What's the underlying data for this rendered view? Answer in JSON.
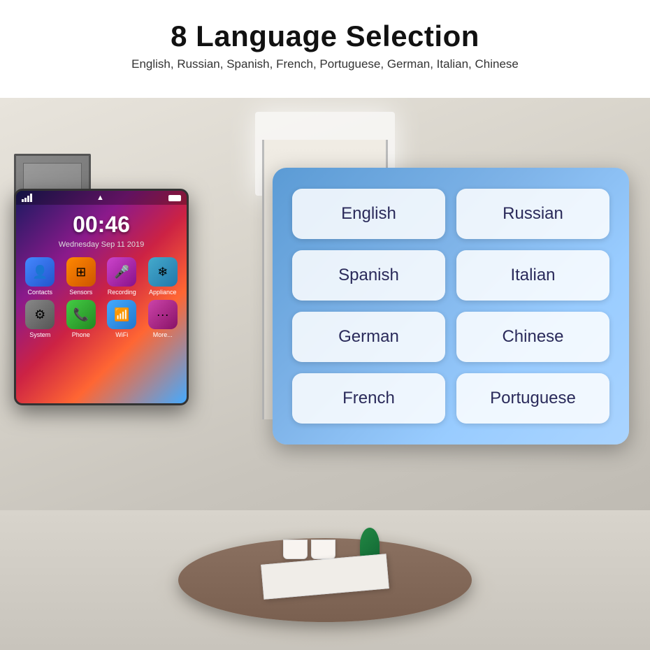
{
  "header": {
    "title": "8 Language Selection",
    "subtitle": "English, Russian, Spanish, French, Portuguese, German, Italian, Chinese"
  },
  "phone": {
    "time": "00:46",
    "day_date": "Wednesday    Sep 11 2019",
    "icons": [
      {
        "label": "Contacts",
        "class": "icon-contacts",
        "symbol": "👤"
      },
      {
        "label": "Sensors",
        "class": "icon-sensors",
        "symbol": "⊞"
      },
      {
        "label": "Recording",
        "class": "icon-recording",
        "symbol": "🎤"
      },
      {
        "label": "Appliance",
        "class": "icon-appliance",
        "symbol": "❄"
      },
      {
        "label": "System",
        "class": "icon-system",
        "symbol": "⚙"
      },
      {
        "label": "Phone",
        "class": "icon-phone",
        "symbol": "📞"
      },
      {
        "label": "WiFi",
        "class": "icon-wifi",
        "symbol": "📶"
      },
      {
        "label": "More...",
        "class": "icon-more",
        "symbol": "···"
      }
    ]
  },
  "languages": {
    "buttons": [
      {
        "label": "English",
        "row": 0,
        "col": 0
      },
      {
        "label": "Russian",
        "row": 0,
        "col": 1
      },
      {
        "label": "Spanish",
        "row": 1,
        "col": 0
      },
      {
        "label": "Italian",
        "row": 1,
        "col": 1
      },
      {
        "label": "German",
        "row": 2,
        "col": 0
      },
      {
        "label": "Chinese",
        "row": 2,
        "col": 1
      },
      {
        "label": "French",
        "row": 3,
        "col": 0
      },
      {
        "label": "Portuguese",
        "row": 3,
        "col": 1
      }
    ]
  }
}
